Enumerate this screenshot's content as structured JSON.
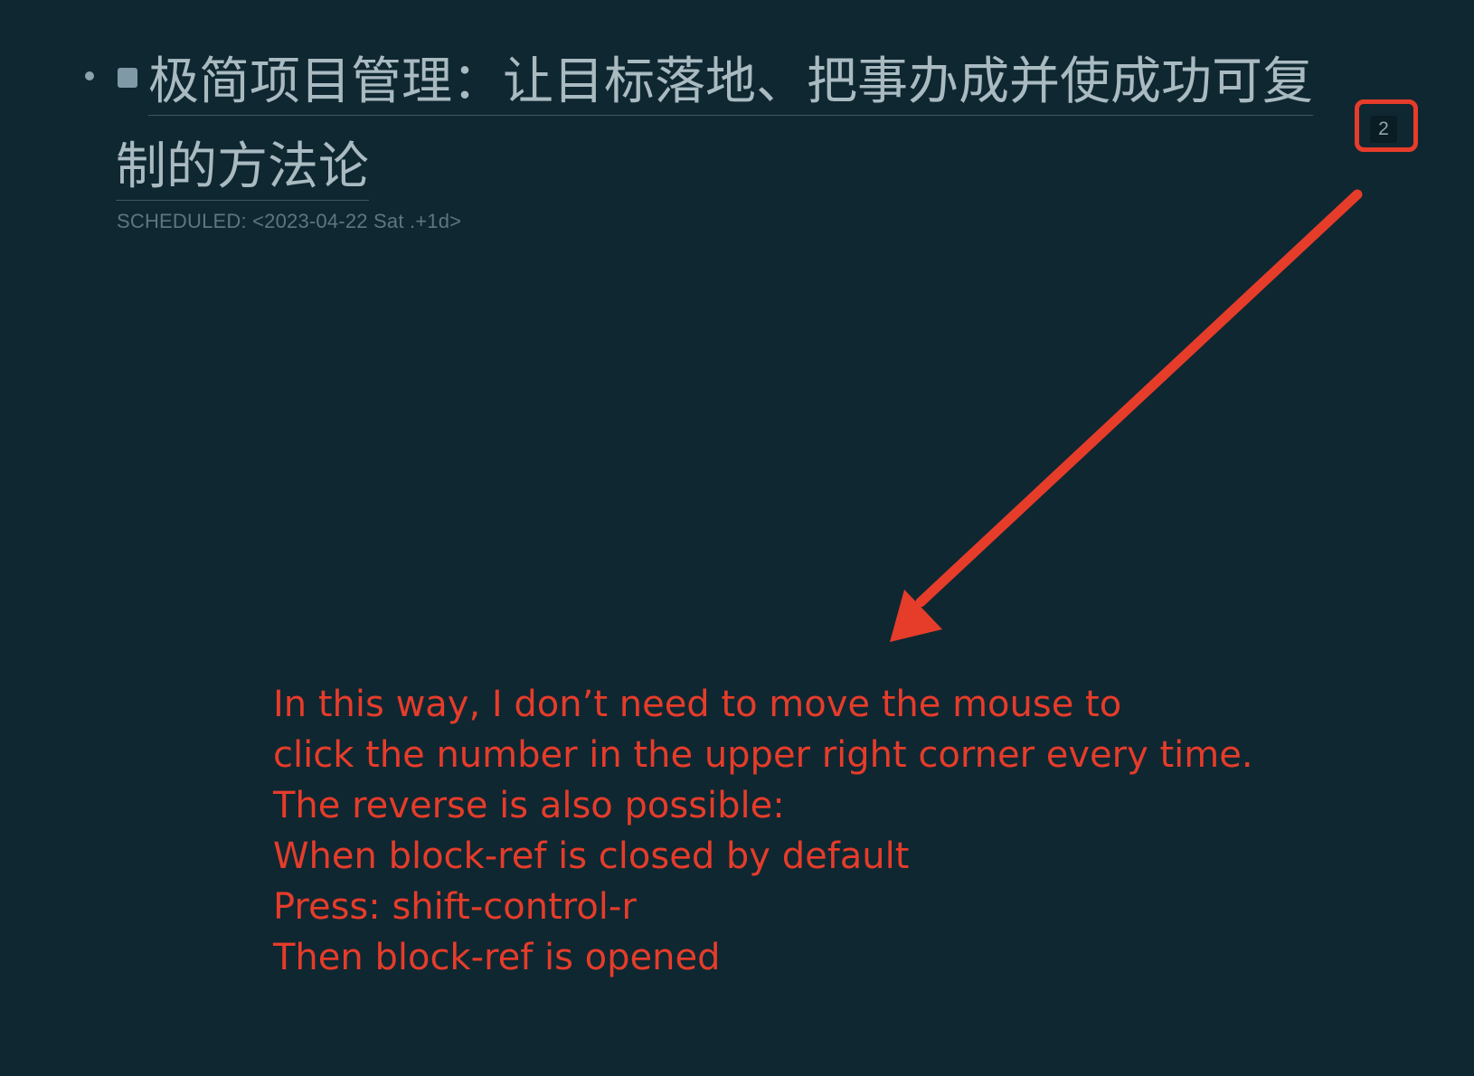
{
  "block": {
    "title": "极简项目管理：让目标落地、把事办成并使成功可复制的方法论",
    "scheduled": "SCHEDULED: <2023-04-22 Sat .+1d>",
    "ref_count": "2"
  },
  "annotation": {
    "lines": [
      "In this way, I don’t need to move the mouse to",
      "click the number in the upper right corner every time.",
      "The reverse is also possible:",
      "When block-ref is closed by default",
      "Press: shift-control-r",
      "Then block-ref is opened"
    ]
  },
  "colors": {
    "background": "#0f2731",
    "title_text": "#a9bac1",
    "muted_text": "#5d7680",
    "annotation_red": "#e63c2a"
  },
  "icons": {
    "bullet": "bullet-dot-icon",
    "todo_marker": "square-marker-icon",
    "arrow": "arrow-down-left-icon"
  }
}
